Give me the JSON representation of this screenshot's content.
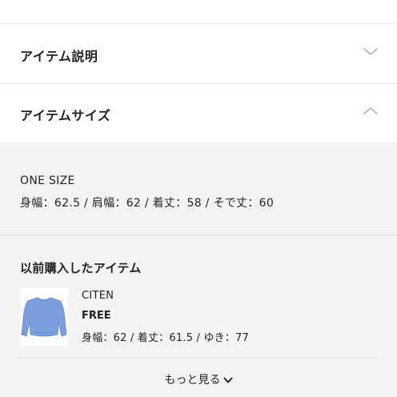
{
  "accordion": {
    "description_label": "アイテム説明",
    "size_label": "アイテムサイズ"
  },
  "size_panel": {
    "size_name": "ONE SIZE",
    "size_detail": "身幅：62.5 / 肩幅：62 / 着丈：58 / そで丈：60"
  },
  "previous": {
    "title": "以前購入したアイテム",
    "item": {
      "brand": "CITEN",
      "size": "FREE",
      "measurements": "身幅：62 / 着丈：61.5 / ゆき：77"
    },
    "more_label": "もっと見る"
  },
  "colors": {
    "panel_bg": "#f3f3f3",
    "chevron": "#b5b5b5",
    "sweater": "#7a9fdc"
  },
  "icons": {
    "description_toggle": "chevron-down-icon",
    "size_toggle": "chevron-up-icon",
    "more_toggle": "chevron-down-icon"
  }
}
